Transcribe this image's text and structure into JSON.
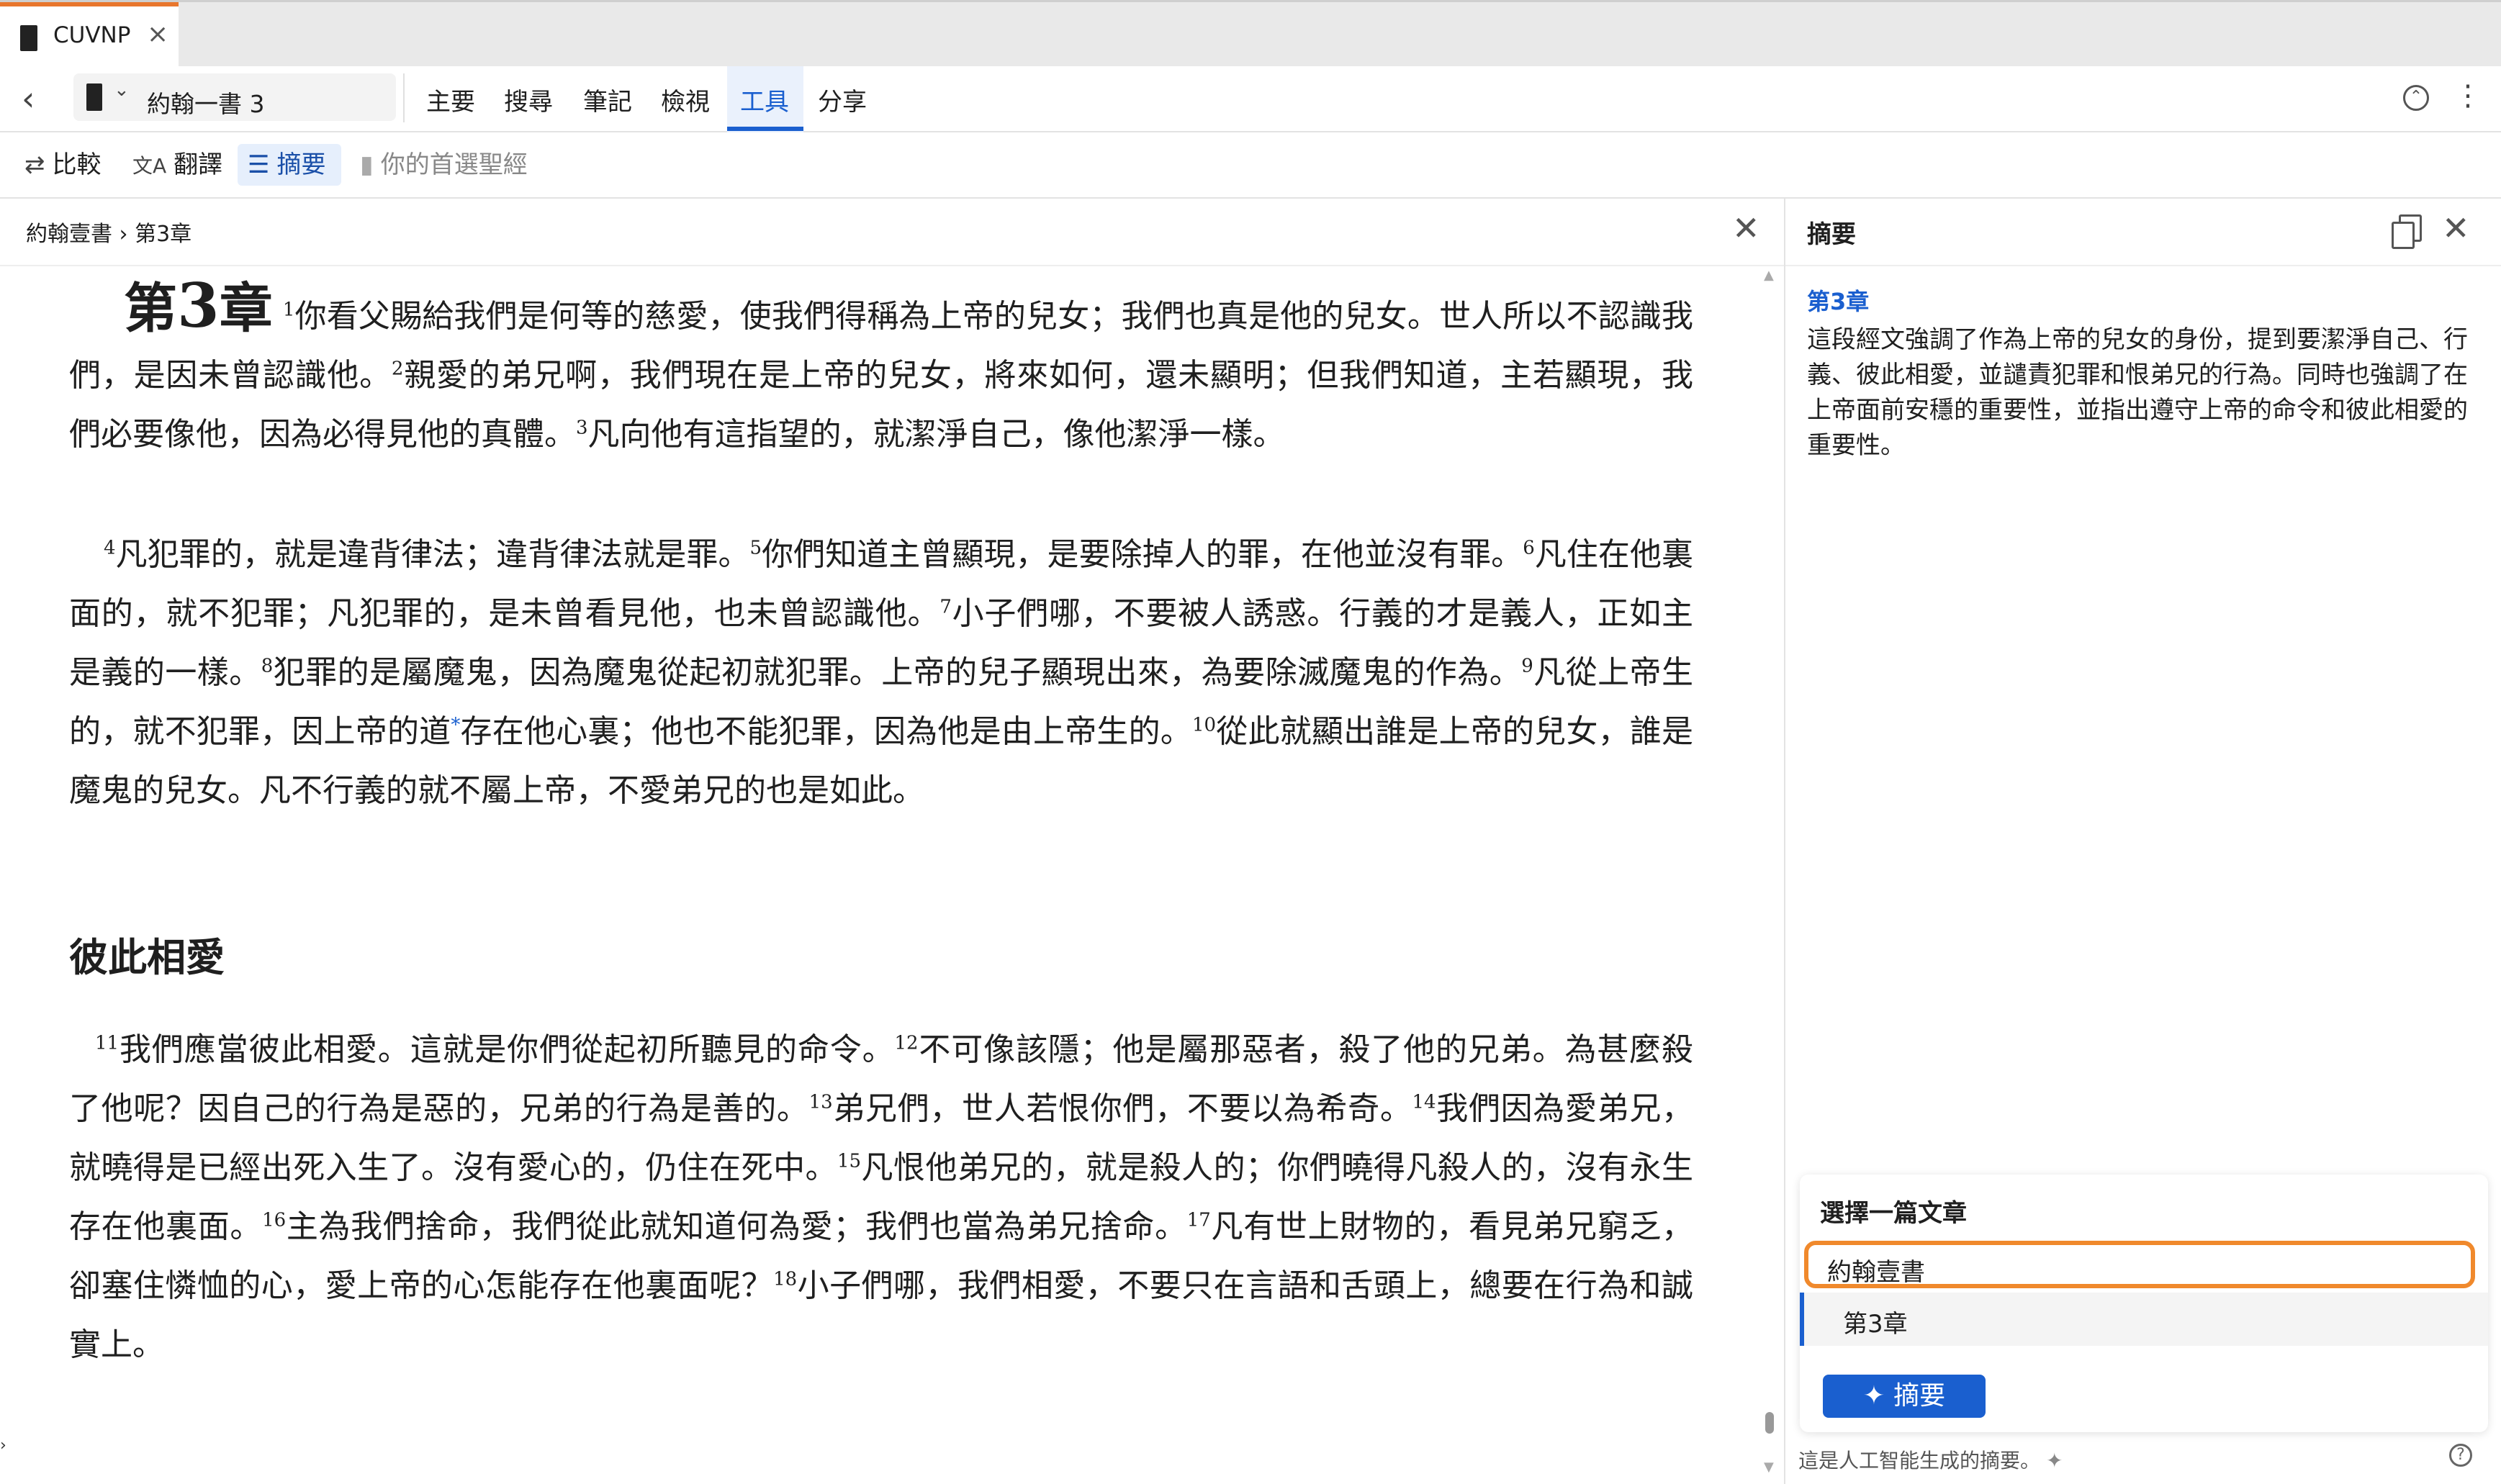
{
  "tab": {
    "label": "CUVNP",
    "close": "×"
  },
  "toolbar": {
    "back": "‹",
    "book_selector": "約翰一書 3",
    "menu": [
      "主要",
      "搜尋",
      "筆記",
      "檢視",
      "工具",
      "分享"
    ],
    "collapse_icon": "⌃",
    "more_icon": "⋮"
  },
  "tools": {
    "compare": "比較",
    "translate": "翻譯",
    "summary": "摘要",
    "preferred": "你的首選聖經",
    "compare_icon": "⇄",
    "translate_icon": "文A",
    "summary_icon": "☰",
    "preferred_icon": "▮"
  },
  "reader": {
    "breadcrumb": "約翰壹書 › 第3章",
    "close": "✕",
    "chapter_prefix": "第",
    "chapter_number": "3",
    "chapter_suffix": "章",
    "section_heading": "彼此相愛",
    "verses": {
      "v1": "你看父賜給我們是何等的慈愛，使我們得稱為上帝的兒女；我們也真是他的兒女。世人所以不認識我們，是因未曾認識他。",
      "v2": "親愛的弟兄啊，我們現在是上帝的兒女，將來如何，還未顯明；但我們知道，主若顯現，我們必要像他，因為必得見他的真體。",
      "v3": "凡向他有這指望的，就潔淨自己，像他潔淨一樣。",
      "v4": "凡犯罪的，就是違背律法；違背律法就是罪。",
      "v5": "你們知道主曾顯現，是要除掉人的罪，在他並沒有罪。",
      "v6": "凡住在他裏面的，就不犯罪；凡犯罪的，是未曾看見他，也未曾認識他。",
      "v7": "小子們哪，不要被人誘惑。行義的才是義人，正如主是義的一樣。",
      "v8": "犯罪的是屬魔鬼，因為魔鬼從起初就犯罪。上帝的兒子顯現出來，為要除滅魔鬼的作為。",
      "v9a": "凡從上帝生的，就不犯罪，因上帝的道",
      "v9fn": "*",
      "v9b": "存在他心裏；他也不能犯罪，因為他是由上帝生的。",
      "v10": "從此就顯出誰是上帝的兒女，誰是魔鬼的兒女。凡不行義的就不屬上帝，不愛弟兄的也是如此。",
      "v11": "我們應當彼此相愛。這就是你們從起初所聽見的命令。",
      "v12": "不可像該隱；他是屬那惡者，殺了他的兄弟。為甚麼殺了他呢？因自己的行為是惡的，兄弟的行為是善的。",
      "v13": "弟兄們，世人若恨你們，不要以為希奇。",
      "v14": "我們因為愛弟兄，就曉得是已經出死入生了。沒有愛心的，仍住在死中。",
      "v15": "凡恨他弟兄的，就是殺人的；你們曉得凡殺人的，沒有永生存在他裏面。",
      "v16": "主為我們捨命，我們從此就知道何為愛；我們也當為弟兄捨命。",
      "v17": "凡有世上財物的，看見弟兄窮乏，卻塞住憐恤的心，愛上帝的心怎能存在他裏面呢？",
      "v18": "小子們哪，我們相愛，不要只在言語和舌頭上，總要在行為和誠實上。"
    }
  },
  "summary_panel": {
    "title": "摘要",
    "chapter_label": "第3章",
    "text": "這段經文強調了作為上帝的兒女的身份，提到要潔淨自己、行義、彼此相愛，並譴責犯罪和恨弟兄的行為。同時也強調了在上帝面前安穩的重要性，並指出遵守上帝的命令和彼此相愛的重要性。",
    "picker_title": "選擇一篇文章",
    "picker_book": "約翰壹書",
    "picker_chapter": "第3章",
    "summarize_button": "摘要",
    "ai_note": "這是人工智能生成的摘要。",
    "help": "?"
  },
  "colors": {
    "accent": "#1a5fcf",
    "tab_top": "#e8762d",
    "highlight_outline": "#f0892c"
  }
}
